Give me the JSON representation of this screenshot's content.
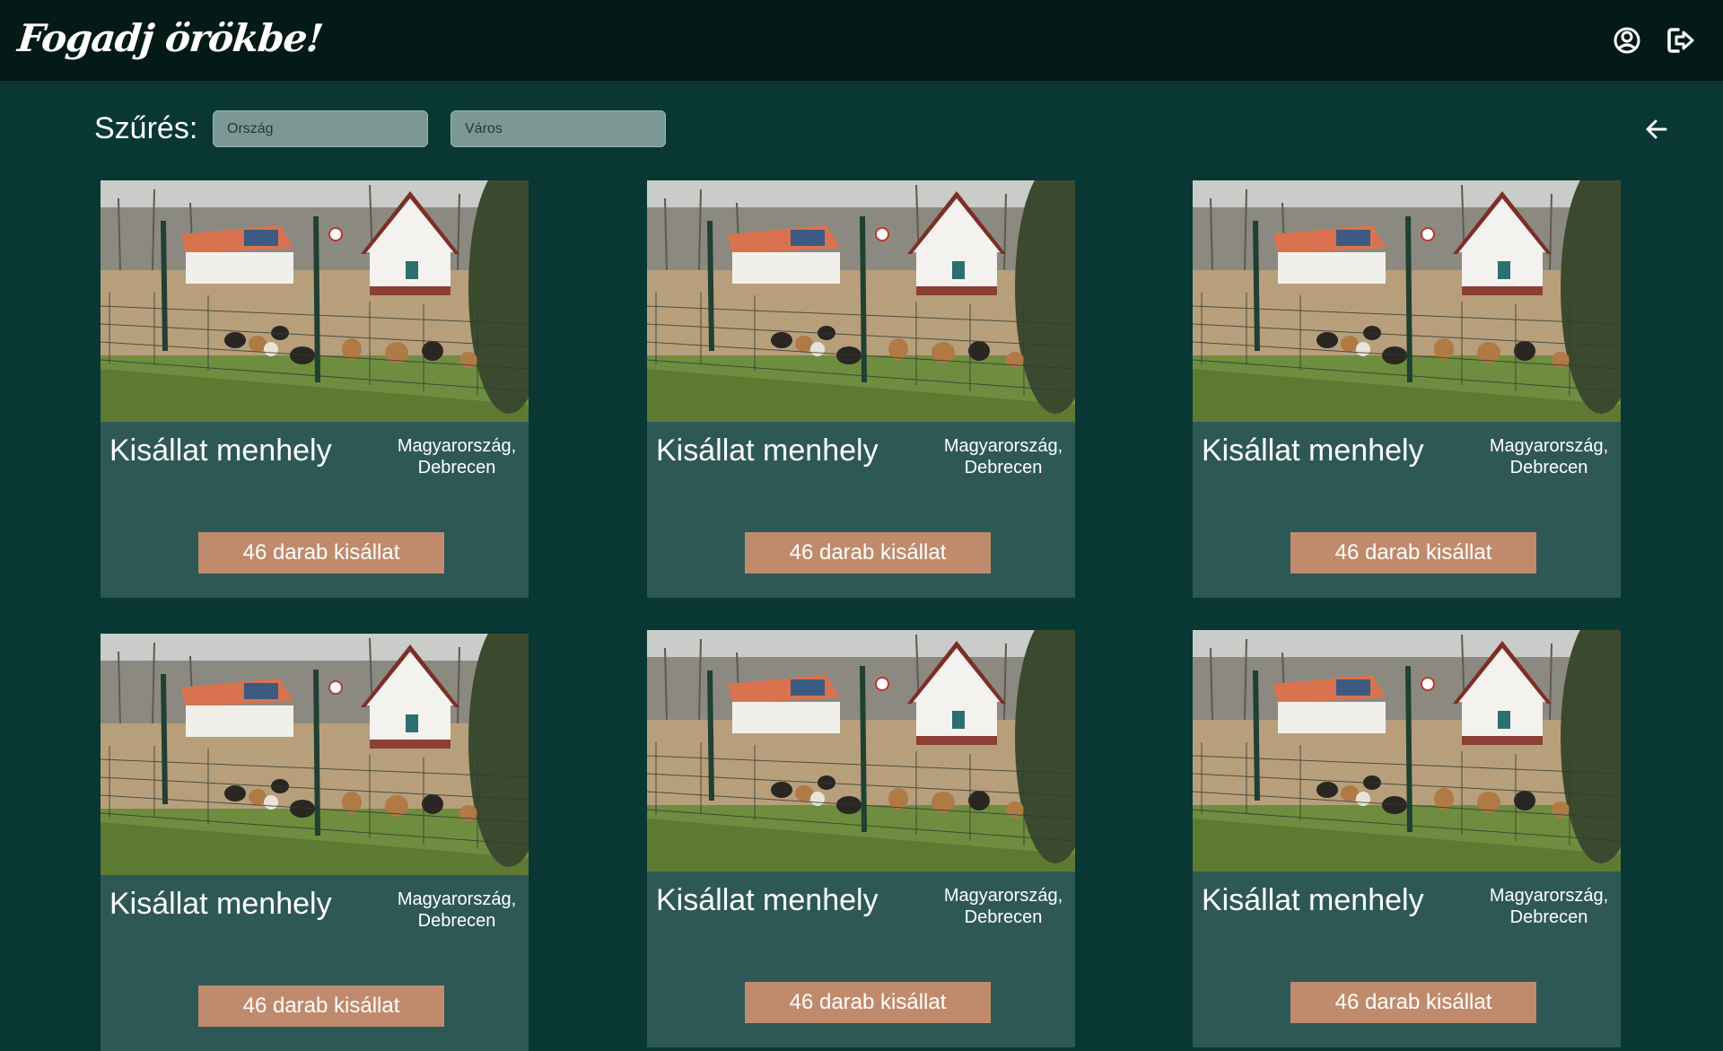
{
  "header": {
    "logo": "Fogadj örökbe!",
    "profile_icon": "user-circle-icon",
    "logout_icon": "logout-icon"
  },
  "filter": {
    "label": "Szűrés:",
    "country_placeholder": "Ország",
    "city_placeholder": "Város",
    "back_icon": "arrow-left-icon"
  },
  "colors": {
    "page_background": "#083734",
    "header_background": "#031a17",
    "card_background": "#2e5856",
    "button_background": "#c08b6d",
    "input_background": "#7b9894"
  },
  "cards": [
    {
      "title": "Kisállat menhely",
      "location_country": "Magyarország,",
      "location_city": "Debrecen",
      "button": "46 darab kisállat",
      "image": "shelter-photo"
    },
    {
      "title": "Kisállat menhely",
      "location_country": "Magyarország,",
      "location_city": "Debrecen",
      "button": "46 darab kisállat",
      "image": "shelter-photo"
    },
    {
      "title": "Kisállat menhely",
      "location_country": "Magyarország,",
      "location_city": "Debrecen",
      "button": "46 darab kisállat",
      "image": "shelter-photo"
    },
    {
      "title": "Kisállat menhely",
      "location_country": "Magyarország,",
      "location_city": "Debrecen",
      "button": "46 darab kisállat",
      "image": "shelter-photo"
    },
    {
      "title": "Kisállat menhely",
      "location_country": "Magyarország,",
      "location_city": "Debrecen",
      "button": "46 darab kisállat",
      "image": "shelter-photo"
    },
    {
      "title": "Kisállat menhely",
      "location_country": "Magyarország,",
      "location_city": "Debrecen",
      "button": "46 darab kisállat",
      "image": "shelter-photo"
    }
  ]
}
